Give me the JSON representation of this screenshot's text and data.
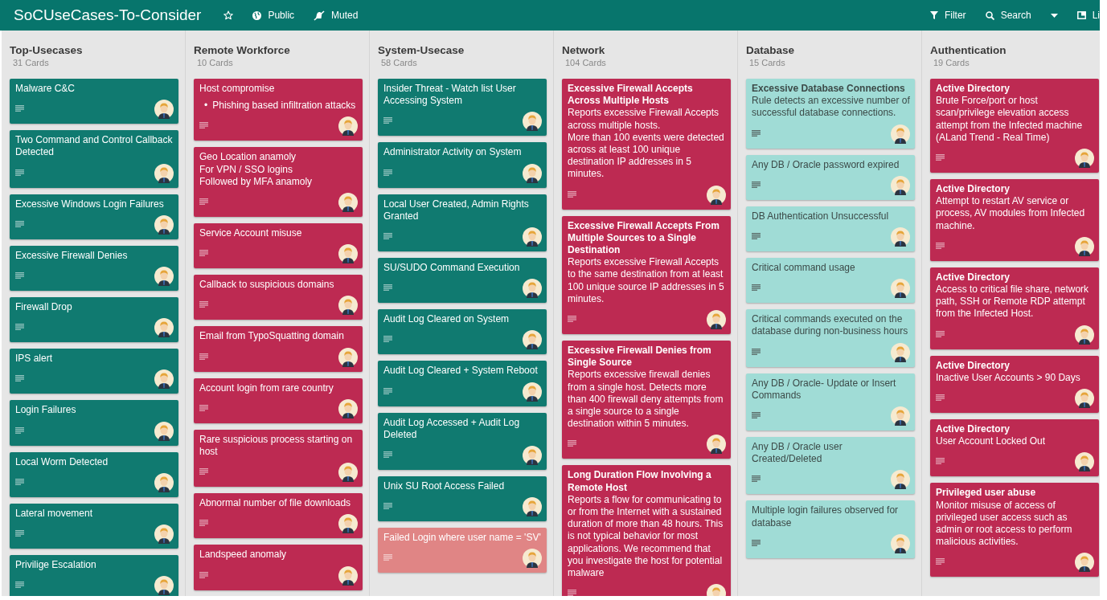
{
  "header": {
    "title": "SoCUseCases-To-Consider",
    "visibility": "Public",
    "notification": "Muted",
    "actions": [
      {
        "kind": "filter",
        "label": "Filter"
      },
      {
        "kind": "search",
        "label": "Search"
      },
      {
        "kind": "caret"
      },
      {
        "kind": "view",
        "label": "Li"
      }
    ]
  },
  "lists": [
    {
      "title": "Top-Usecases",
      "count": "31 Cards",
      "cards": [
        {
          "color": "#107a70",
          "bold_first": false,
          "lines": [
            "Malware C&C"
          ]
        },
        {
          "color": "#107a70",
          "bold_first": false,
          "lines": [
            "Two Command and Control Callback Detected"
          ]
        },
        {
          "color": "#107a70",
          "bold_first": false,
          "lines": [
            "Excessive Windows Login Failures"
          ]
        },
        {
          "color": "#107a70",
          "bold_first": false,
          "lines": [
            "Excessive Firewall Denies"
          ]
        },
        {
          "color": "#107a70",
          "bold_first": false,
          "lines": [
            "Firewall Drop"
          ]
        },
        {
          "color": "#107a70",
          "bold_first": false,
          "lines": [
            "IPS alert"
          ]
        },
        {
          "color": "#107a70",
          "bold_first": false,
          "lines": [
            "Login Failures"
          ]
        },
        {
          "color": "#107a70",
          "bold_first": false,
          "lines": [
            "Local Worm Detected"
          ]
        },
        {
          "color": "#107a70",
          "bold_first": false,
          "lines": [
            "Lateral movement"
          ]
        },
        {
          "color": "#107a70",
          "bold_first": false,
          "lines": [
            "Privilige Escalation"
          ]
        }
      ]
    },
    {
      "title": "Remote Workforce",
      "count": "10 Cards",
      "cards": [
        {
          "color": "#bd2a52",
          "bold_first": false,
          "lines": [
            "Host compromise"
          ],
          "bullets": [
            {
              "marker": "•",
              "text": "Phishing based infiltration attacks"
            }
          ]
        },
        {
          "color": "#bd2a52",
          "bold_first": false,
          "lines": [
            "Geo Location anamoly",
            "For VPN / SSO logins",
            "Followed by MFA anamoly"
          ]
        },
        {
          "color": "#bd2a52",
          "bold_first": false,
          "lines": [
            "Service Account misuse"
          ]
        },
        {
          "color": "#bd2a52",
          "bold_first": false,
          "lines": [
            "Callback to suspicious domains"
          ]
        },
        {
          "color": "#bd2a52",
          "bold_first": false,
          "lines": [
            "Email from TypoSquatting domain"
          ]
        },
        {
          "color": "#bd2a52",
          "bold_first": false,
          "lines": [
            "Account login from rare country"
          ]
        },
        {
          "color": "#bd2a52",
          "bold_first": false,
          "lines": [
            "Rare suspicious process starting on host"
          ]
        },
        {
          "color": "#bd2a52",
          "bold_first": false,
          "lines": [
            "Abnormal number of file downloads"
          ]
        },
        {
          "color": "#bd2a52",
          "bold_first": false,
          "lines": [
            "Landspeed anomaly"
          ]
        }
      ]
    },
    {
      "title": "System-Usecase",
      "count": "58 Cards",
      "cards": [
        {
          "color": "#107a70",
          "bold_first": false,
          "lines": [
            "Insider Threat - Watch list User Accessing System"
          ]
        },
        {
          "color": "#107a70",
          "bold_first": false,
          "lines": [
            "Administrator Activity on System"
          ]
        },
        {
          "color": "#107a70",
          "bold_first": false,
          "lines": [
            "Local User Created, Admin Rights Granted"
          ]
        },
        {
          "color": "#107a70",
          "bold_first": false,
          "lines": [
            "SU/SUDO Command Execution"
          ]
        },
        {
          "color": "#107a70",
          "bold_first": false,
          "lines": [
            "Audit Log Cleared on System"
          ]
        },
        {
          "color": "#107a70",
          "bold_first": false,
          "lines": [
            "Audit Log Cleared + System Reboot"
          ]
        },
        {
          "color": "#107a70",
          "bold_first": false,
          "lines": [
            "Audit Log Accessed + Audit Log Deleted"
          ]
        },
        {
          "color": "#107a70",
          "bold_first": false,
          "lines": [
            "Unix SU Root Access Failed"
          ]
        },
        {
          "color": "#e08585",
          "bold_first": false,
          "lines": [
            "Failed Login where user name = 'SV'"
          ]
        }
      ]
    },
    {
      "title": "Network",
      "count": "104 Cards",
      "cards": [
        {
          "color": "#bd2a52",
          "bold_first": true,
          "lines": [
            "Excessive Firewall Accepts Across Multiple Hosts",
            "Reports excessive Firewall Accepts across multiple hosts.",
            "More than 100 events were detected across at least 100 unique destination IP addresses in 5 minutes."
          ]
        },
        {
          "color": "#bd2a52",
          "bold_first": true,
          "lines": [
            "Excessive Firewall Accepts From Multiple Sources to a Single Destination",
            "Reports excessive Firewall Accepts to the same destination from at least 100 unique source IP addresses in 5 minutes."
          ]
        },
        {
          "color": "#bd2a52",
          "bold_first": true,
          "lines": [
            "Excessive Firewall Denies from Single Source",
            "Reports excessive firewall denies from a single host. Detects more than 400 firewall deny attempts from a single source to a single destination within 5 minutes."
          ]
        },
        {
          "color": "#bd2a52",
          "bold_first": true,
          "lines": [
            "Long Duration Flow Involving a Remote Host",
            "Reports a flow for communicating to or from the Internet with a sustained duration of more than 48 hours. This is not typical behavior for most applications. We recommend that you investigate the host for potential malware"
          ]
        }
      ]
    },
    {
      "title": "Database",
      "count": "15 Cards",
      "cards": [
        {
          "color": "#a0dcd6",
          "bold_first": true,
          "lines": [
            "Excessive Database Connections",
            "Rule detects an excessive number of successful database connections."
          ]
        },
        {
          "color": "#a0dcd6",
          "bold_first": false,
          "lines": [
            "Any DB / Oracle password expired"
          ]
        },
        {
          "color": "#a0dcd6",
          "bold_first": false,
          "lines": [
            "DB Authentication Unsuccessful"
          ]
        },
        {
          "color": "#a0dcd6",
          "bold_first": false,
          "lines": [
            "Critical command usage"
          ]
        },
        {
          "color": "#a0dcd6",
          "bold_first": false,
          "lines": [
            "Critical commands executed on the database during non-business hours"
          ]
        },
        {
          "color": "#a0dcd6",
          "bold_first": false,
          "lines": [
            "Any DB / Oracle- Update or Insert Commands"
          ]
        },
        {
          "color": "#a0dcd6",
          "bold_first": false,
          "lines": [
            "Any DB / Oracle user Created/Deleted"
          ]
        },
        {
          "color": "#a0dcd6",
          "bold_first": false,
          "lines": [
            "Multiple login failures observed for database"
          ]
        }
      ]
    },
    {
      "title": "Authentication",
      "count": "19 Cards",
      "cards": [
        {
          "color": "#bd2a52",
          "bold_first": true,
          "lines": [
            "Active Directory",
            "Brute Force/port or host scan/privilege elevation access attempt from the Infected machine (ALand Trend - Real Time)"
          ]
        },
        {
          "color": "#bd2a52",
          "bold_first": true,
          "lines": [
            "Active Directory",
            "Attempt to restart AV service or process, AV modules from Infected machine."
          ]
        },
        {
          "color": "#bd2a52",
          "bold_first": true,
          "lines": [
            "Active Directory",
            "Access to critical file share, network path, SSH or Remote RDP attempt from the Infected Host."
          ]
        },
        {
          "color": "#bd2a52",
          "bold_first": true,
          "lines": [
            "Active Directory",
            "Inactive User Accounts > 90 Days"
          ]
        },
        {
          "color": "#bd2a52",
          "bold_first": true,
          "lines": [
            "Active Directory",
            "User Account Locked Out"
          ]
        },
        {
          "color": "#bd2a52",
          "bold_first": true,
          "lines": [
            "Privileged user abuse",
            "Monitor misuse of access of privileged user access such as admin or root access to perform malicious activities."
          ]
        }
      ]
    }
  ]
}
